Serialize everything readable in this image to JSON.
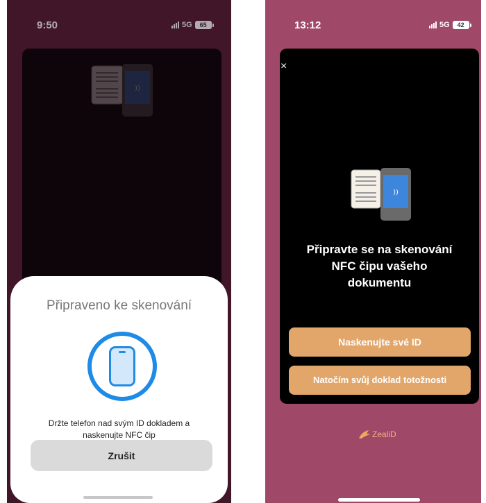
{
  "left_phone": {
    "status": {
      "time": "9:50",
      "network": "5G",
      "battery": "65"
    },
    "sheet": {
      "title": "Připraveno ke skenování",
      "message_lines": [
        "Držte telefon nad svým ID dokladem a",
        "naskenujte NFC čip"
      ],
      "cancel_label": "Zrušit"
    }
  },
  "right_phone": {
    "status": {
      "time": "13:12",
      "network": "5G",
      "battery": "42"
    },
    "close_label": "×",
    "heading_lines": [
      "Připravte se na skenování",
      "NFC čipu vašeho",
      "dokumentu"
    ],
    "primary_button": "Naskenujte své ID",
    "secondary_button": "Natočím svůj doklad totožnosti",
    "brand": "ZealiD"
  },
  "colors": {
    "left_background": "#4d1b2f",
    "right_background": "#a04868",
    "accent_button": "#e2a66a",
    "nfc_blue": "#1e8be6"
  }
}
